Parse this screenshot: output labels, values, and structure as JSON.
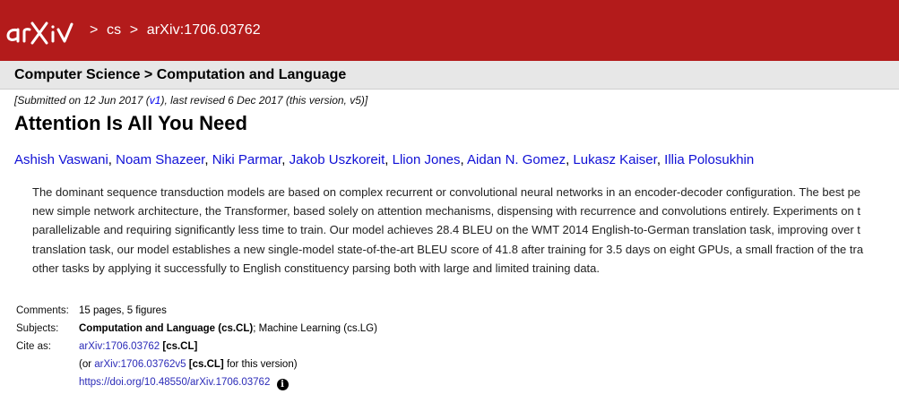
{
  "header": {
    "logo_text": "arXiv",
    "breadcrumb": [
      {
        "label": "cs"
      },
      {
        "label": "arXiv:1706.03762"
      }
    ],
    "separator": ">"
  },
  "subheader": {
    "title": "Computer Science > Computation and Language"
  },
  "paper": {
    "dateline": {
      "prefix": "[Submitted on 12 Jun 2017 (",
      "v1_label": "v1",
      "suffix": "), last revised 6 Dec 2017 (this version, v5)]"
    },
    "title": "Attention Is All You Need",
    "authors": [
      "Ashish Vaswani",
      "Noam Shazeer",
      "Niki Parmar",
      "Jakob Uszkoreit",
      "Llion Jones",
      "Aidan N. Gomez",
      "Lukasz Kaiser",
      "Illia Polosukhin"
    ],
    "abstract_lines": [
      "The dominant sequence transduction models are based on complex recurrent or convolutional neural networks in an encoder-decoder configuration. The best pe",
      "new simple network architecture, the Transformer, based solely on attention mechanisms, dispensing with recurrence and convolutions entirely. Experiments on t",
      "parallelizable and requiring significantly less time to train. Our model achieves 28.4 BLEU on the WMT 2014 English-to-German translation task, improving over t",
      "translation task, our model establishes a new single-model state-of-the-art BLEU score of 41.8 after training for 3.5 days on eight GPUs, a small fraction of the tra",
      "other tasks by applying it successfully to English constituency parsing both with large and limited training data."
    ]
  },
  "metadata": {
    "comments": {
      "label": "Comments:",
      "value": "15 pages, 5 figures"
    },
    "subjects": {
      "label": "Subjects:",
      "primary": "Computation and Language (cs.CL)",
      "secondary": "; Machine Learning (cs.LG)"
    },
    "cite": {
      "label": "Cite as:",
      "id_link": "arXiv:1706.03762",
      "id_tag": "[cs.CL]",
      "version_prefix": "(or ",
      "version_link": "arXiv:1706.03762v5",
      "version_tag": "[cs.CL]",
      "version_suffix": " for this version)",
      "doi": "https://doi.org/10.48550/arXiv.1706.03762",
      "info_icon": "i"
    }
  },
  "colors": {
    "header_bg": "#b31b1b",
    "subheader_bg": "#e7e7e7",
    "link": "#1010d6"
  }
}
